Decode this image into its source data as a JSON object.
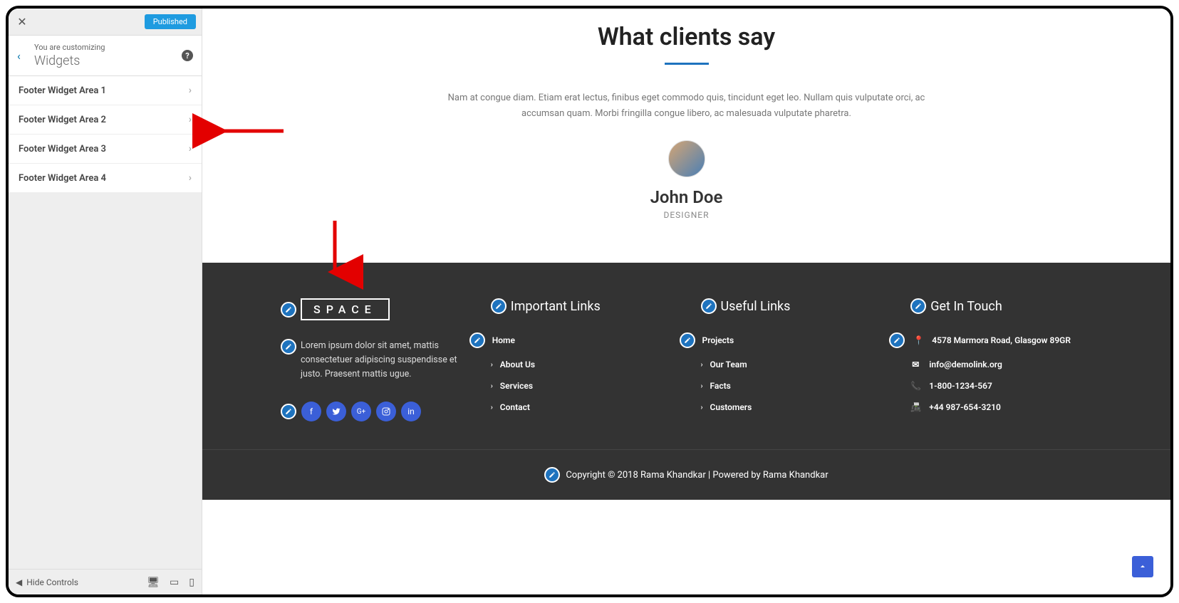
{
  "sidebar": {
    "publish_label": "Published",
    "customizing_label": "You are customizing",
    "panel_title": "Widgets",
    "items": [
      {
        "label": "Footer Widget Area 1"
      },
      {
        "label": "Footer Widget Area 2"
      },
      {
        "label": "Footer Widget Area 3"
      },
      {
        "label": "Footer Widget Area 4"
      }
    ],
    "hide_controls": "Hide Controls"
  },
  "preview": {
    "testimonial": {
      "heading": "What clients say",
      "text": "Nam at congue diam. Etiam erat lectus, finibus eget commodo quis, tincidunt eget leo. Nullam quis vulputate orci, ac accumsan quam. Morbi fringilla congue libero, ac malesuada vulputate pharetra.",
      "name": "John Doe",
      "role": "DESIGNER"
    },
    "footer": {
      "logo_text": "SPACE",
      "description": "Lorem ipsum dolor sit amet, mattis consectetuer adipiscing suspendisse et justo. Praesent mattis ugue.",
      "col2": {
        "title": "Important Links",
        "links": [
          "Home",
          "About Us",
          "Services",
          "Contact"
        ]
      },
      "col3": {
        "title": "Useful Links",
        "links": [
          "Projects",
          "Our Team",
          "Facts",
          "Customers"
        ]
      },
      "col4": {
        "title": "Get In Touch",
        "address": "4578 Marmora Road, Glasgow 89GR",
        "email": "info@demolink.org",
        "phone1": "1-800-1234-567",
        "phone2": "+44 987-654-3210"
      },
      "copyright": "Copyright © 2018 Rama Khandkar | Powered by Rama Khandkar"
    }
  }
}
